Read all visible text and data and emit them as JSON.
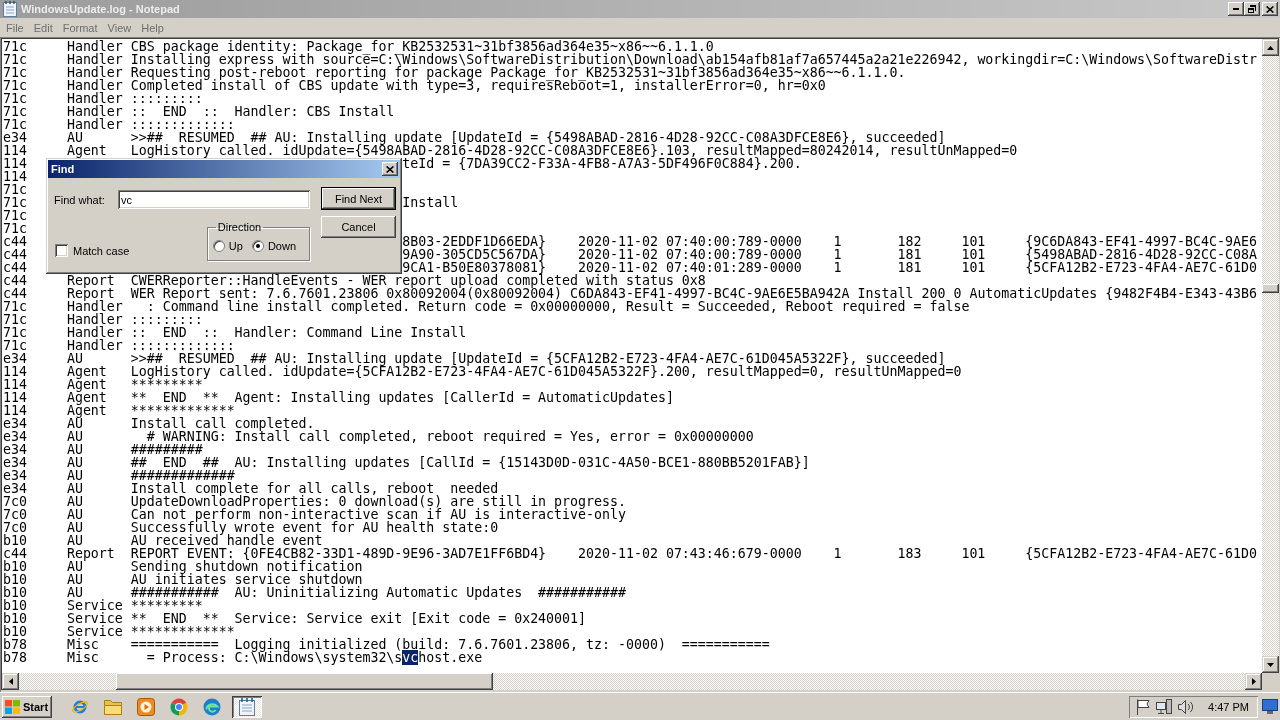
{
  "window": {
    "title": "WindowsUpdate.log - Notepad"
  },
  "menu_bar": [
    "File",
    "Edit",
    "Format",
    "View",
    "Help"
  ],
  "editor": {
    "lines": [
      {
        "kind": "full",
        "text": "71c\tHandler\tCBS package identity: Package_for_KB2532531~31bf3856ad364e35~x86~~6.1.1.0"
      },
      {
        "kind": "full",
        "text": "71c\tHandler\tInstalling express with source=C:\\Windows\\SoftwareDistribution\\Download\\ab154afb81af7a657445a2a21e226942, workingdir=C:\\Windows\\SoftwareDistr"
      },
      {
        "kind": "full",
        "text": "71c\tHandler\tRequesting post-reboot reporting for package Package_for_KB2532531~31bf3856ad364e35~x86~~6.1.1.0."
      },
      {
        "kind": "full",
        "text": "71c\tHandler\tCompleted install of CBS update with type=3, requiresReboot=1, installerError=0, hr=0x0"
      },
      {
        "kind": "full",
        "text": "71c\tHandler\t:::::::::"
      },
      {
        "kind": "full",
        "text": "71c\tHandler\t::  END  ::  Handler: CBS Install"
      },
      {
        "kind": "full",
        "text": "71c\tHandler\t:::::::::::::"
      },
      {
        "kind": "full",
        "text": "e34\tAU\t>>##  RESUMED  ## AU: Installing update [UpdateId = {5498ABAD-2816-4D28-92CC-C08A3DFCE8E6}, succeeded]"
      },
      {
        "kind": "full",
        "text": "114\tAgent\tLogHistory called. idUpdate={5498ABAD-2816-4D28-92CC-C08A3DFCE8E6}.103, resultMapped=80242014, resultUnMapped=0"
      },
      {
        "kind": "covered",
        "thread": "114",
        "tail": "teId = {7DA39CC2-F33A-4FB8-A7A3-5DF496F0C884}.200."
      },
      {
        "kind": "covered",
        "thread": "114"
      },
      {
        "kind": "covered",
        "thread": "71c"
      },
      {
        "kind": "covered",
        "thread": "71c",
        "tail": "Install"
      },
      {
        "kind": "covered",
        "thread": "71c"
      },
      {
        "kind": "covered",
        "thread": "71c"
      },
      {
        "kind": "covered",
        "thread": "c44",
        "tail": "8B03-2EDDF1D66EDA}\t2020-11-02 07:40:00:789-0000\t1\t182\t101\t{9C6DA843-EF41-4997-BC4C-9AE6"
      },
      {
        "kind": "covered",
        "thread": "c44",
        "tail": "9A90-305CD5C567DA}\t2020-11-02 07:40:00:789-0000\t1\t181\t101\t{5498ABAD-2816-4D28-92CC-C08A"
      },
      {
        "kind": "covered",
        "thread": "c44",
        "tail": "9CA1-B50E80378081}\t2020-11-02 07:40:01:289-0000\t1\t181\t101\t{5CFA12B2-E723-4FA4-AE7C-61D0"
      },
      {
        "kind": "full",
        "text": "c44\tReport\tCWERReporter::HandleEvents - WER report upload completed with status 0x8"
      },
      {
        "kind": "full",
        "text": "c44\tReport\tWER Report sent: 7.6.7601.23806 0x80092004(0x80092004) C6DA843-EF41-4997-BC4C-9AE6E5BA942A Install 200 0 AutomaticUpdates {9482F4B4-E343-43B6"
      },
      {
        "kind": "full",
        "text": "71c\tHandler\t  : Command line install completed. Return code = 0x00000000, Result = Succeeded, Reboot required = false"
      },
      {
        "kind": "full",
        "text": "71c\tHandler\t:::::::::"
      },
      {
        "kind": "full",
        "text": "71c\tHandler\t::  END  ::  Handler: Command Line Install"
      },
      {
        "kind": "full",
        "text": "71c\tHandler\t:::::::::::::"
      },
      {
        "kind": "full",
        "text": "e34\tAU\t>>##  RESUMED  ## AU: Installing update [UpdateId = {5CFA12B2-E723-4FA4-AE7C-61D045A5322F}, succeeded]"
      },
      {
        "kind": "full",
        "text": "114\tAgent\tLogHistory called. idUpdate={5CFA12B2-E723-4FA4-AE7C-61D045A5322F}.200, resultMapped=0, resultUnMapped=0"
      },
      {
        "kind": "full",
        "text": "114\tAgent\t*********"
      },
      {
        "kind": "full",
        "text": "114\tAgent\t**  END  **  Agent: Installing updates [CallerId = AutomaticUpdates]"
      },
      {
        "kind": "full",
        "text": "114\tAgent\t*************"
      },
      {
        "kind": "full",
        "text": "e34\tAU\tInstall call completed."
      },
      {
        "kind": "full",
        "text": "e34\tAU\t  # WARNING: Install call completed, reboot required = Yes, error = 0x00000000"
      },
      {
        "kind": "full",
        "text": "e34\tAU\t#########"
      },
      {
        "kind": "full",
        "text": "e34\tAU\t##  END  ##  AU: Installing updates [CallId = {15143D0D-031C-4A50-BCE1-880BB5201FAB}]"
      },
      {
        "kind": "full",
        "text": "e34\tAU\t#############"
      },
      {
        "kind": "full",
        "text": "e34\tAU\tInstall complete for all calls, reboot  needed"
      },
      {
        "kind": "full",
        "text": "7c0\tAU\tUpdateDownloadProperties: 0 download(s) are still in progress."
      },
      {
        "kind": "full",
        "text": "7c0\tAU\tCan not perform non-interactive scan if AU is interactive-only"
      },
      {
        "kind": "full",
        "text": "7c0\tAU\tSuccessfully wrote event for AU health state:0"
      },
      {
        "kind": "full",
        "text": "b10\tAU\tAU received handle event"
      },
      {
        "kind": "full",
        "text": "c44\tReport\tREPORT EVENT: {0FE4CB82-33D1-489D-9E96-3AD7E1FF6BD4}\t2020-11-02 07:43:46:679-0000\t1\t183\t101\t{5CFA12B2-E723-4FA4-AE7C-61D0"
      },
      {
        "kind": "full",
        "text": "b10\tAU\tSending shutdown notification"
      },
      {
        "kind": "full",
        "text": "b10\tAU\tAU initiates service shutdown"
      },
      {
        "kind": "full",
        "text": "b10\tAU\t###########  AU: Uninitializing Automatic Updates  ###########"
      },
      {
        "kind": "full",
        "text": "b10\tService\t*********"
      },
      {
        "kind": "full",
        "text": "b10\tService\t**  END  **  Service: Service exit [Exit code = 0x240001]"
      },
      {
        "kind": "full",
        "text": "b10\tService\t*************"
      },
      {
        "kind": "full",
        "text": "b78\tMisc\t===========  Logging initialized (build: 7.6.7601.23806, tz: -0000)  ==========="
      },
      {
        "kind": "selection",
        "parts": [
          {
            "text": "b78\tMisc\t  = Process: C:\\Windows\\system32\\s",
            "selected": false
          },
          {
            "text": "vc",
            "selected": true
          },
          {
            "text": "host.exe",
            "selected": false
          }
        ]
      }
    ]
  },
  "find_dialog": {
    "title": "Find",
    "find_what": {
      "label": "Find what:",
      "value": "vc"
    },
    "buttons": [
      {
        "label": "Find Next",
        "default": true
      },
      {
        "label": "Cancel",
        "default": false
      }
    ],
    "direction": {
      "label": "Direction",
      "options": [
        {
          "label": "Up",
          "selected": false
        },
        {
          "label": "Down",
          "selected": true
        }
      ]
    },
    "match_case": {
      "label": "Match case",
      "checked": false
    }
  },
  "taskbar": {
    "start_label": "Start",
    "task_button": {
      "active": true
    },
    "clock": "4:47 PM"
  }
}
